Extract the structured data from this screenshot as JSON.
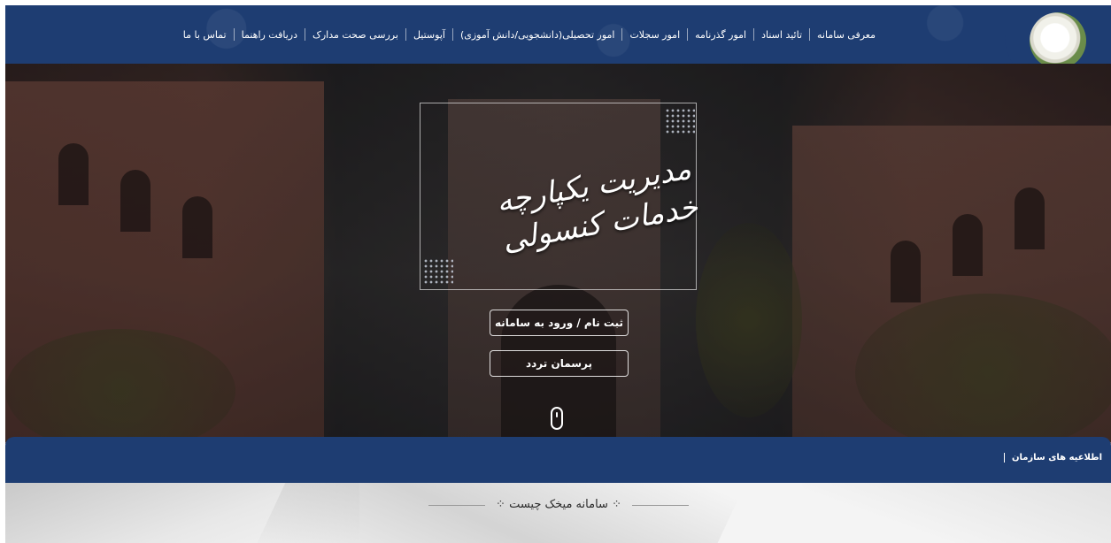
{
  "header": {
    "nav_items": [
      "معرفی سامانه",
      "تائید اسناد",
      "امور گذرنامه",
      "امور سجلات",
      "امور تحصیلی(دانشجویی/دانش آموزی)",
      "آپوستیل",
      "بررسی صحت مدارک",
      "دریافت راهنما",
      "تماس با ما"
    ]
  },
  "hero": {
    "headline": "مدیریت یکپارچه خدمات کنسولی",
    "register_button": "ثبت نام / ورود به سامانه",
    "survey_button": "پرسمان تردد"
  },
  "notice_bar": {
    "label": "اطلاعیه های سازمان"
  },
  "section": {
    "title": "سامانه میخک چیست"
  },
  "colors": {
    "primary_navy": "#1e3d72",
    "white": "#ffffff"
  },
  "icons": [
    "logo-flower",
    "mouse-scroll-icon",
    "chevron-down-icon",
    "ornament-icon"
  ]
}
